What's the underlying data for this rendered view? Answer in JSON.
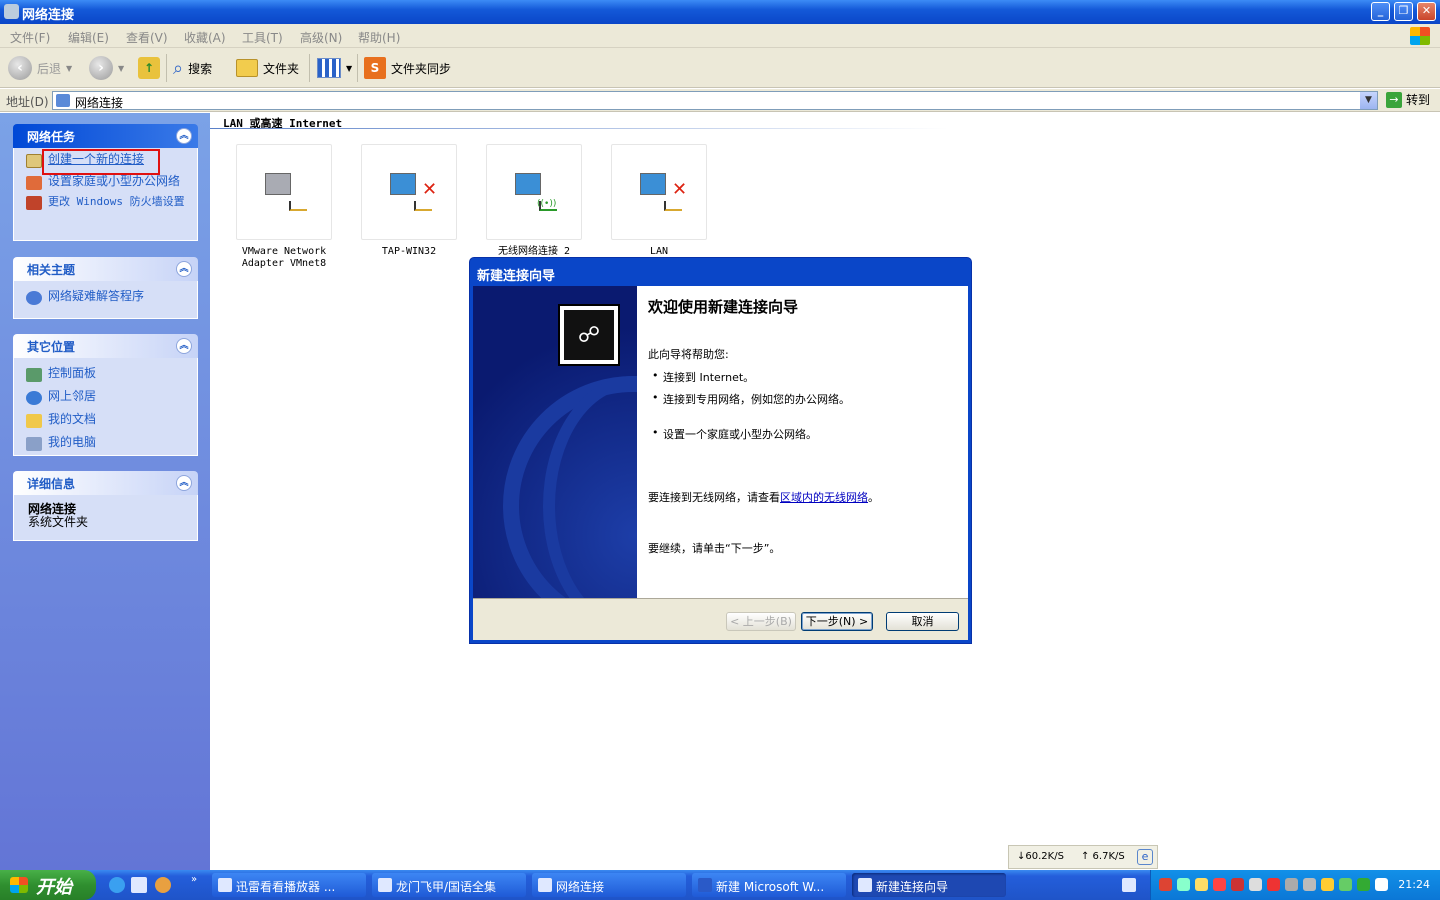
{
  "window": {
    "title": "网络连接"
  },
  "menu": [
    "文件(F)",
    "编辑(E)",
    "查看(V)",
    "收藏(A)",
    "工具(T)",
    "高级(N)",
    "帮助(H)"
  ],
  "toolbar": {
    "back": "后退",
    "search": "搜索",
    "folders": "文件夹",
    "sync": "文件夹同步"
  },
  "address": {
    "label": "地址(D)",
    "value": "网络连接",
    "go": "转到"
  },
  "sidebar": {
    "network_tasks": {
      "title": "网络任务",
      "items": [
        "创建一个新的连接",
        "设置家庭或小型办公网络",
        "更改 Windows 防火墙设置"
      ]
    },
    "related": {
      "title": "相关主题",
      "items": [
        "网络疑难解答程序"
      ]
    },
    "other_places": {
      "title": "其它位置",
      "items": [
        "控制面板",
        "网上邻居",
        "我的文档",
        "我的电脑"
      ]
    },
    "details": {
      "title": "详细信息",
      "name": "网络连接",
      "type": "系统文件夹"
    }
  },
  "content": {
    "group_header": "LAN 或高速 Internet",
    "connections": [
      {
        "label": "VMware Network Adapter VMnet8"
      },
      {
        "label": "TAP-WIN32"
      },
      {
        "label": "无线网络连接 2"
      },
      {
        "label": "LAN"
      }
    ]
  },
  "dialog": {
    "title": "新建连接向导",
    "heading": "欢迎使用新建连接向导",
    "intro": "此向导将帮助您:",
    "bullets": [
      "连接到 Internet。",
      "连接到专用网络，例如您的办公网络。",
      "设置一个家庭或小型办公网络。"
    ],
    "wireless_prefix": "要连接到无线网络，请查看",
    "wireless_link": "区域内的无线网络",
    "wireless_suffix": "。",
    "continue": "要继续，请单击“下一步”。",
    "buttons": {
      "back": "< 上一步(B)",
      "next": "下一步(N) >",
      "cancel": "取消"
    }
  },
  "netspeed": {
    "down": "↓60.2K/S",
    "up": "↑ 6.7K/S"
  },
  "taskbar": {
    "start": "开始",
    "windows": [
      "迅雷看看播放器 ...",
      "龙门飞甲/国语全集",
      "网络连接",
      "新建 Microsoft W...",
      "新建连接向导"
    ],
    "clock": "21:24"
  },
  "colors": {
    "accent": "#215dc6",
    "titlebar": "#0a46c8",
    "highlight_box": "#e01010"
  }
}
